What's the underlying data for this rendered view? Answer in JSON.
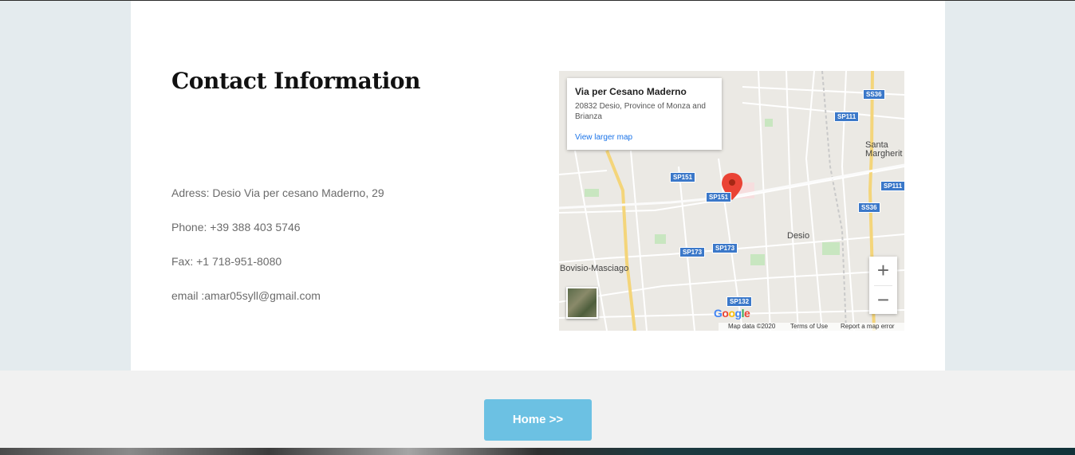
{
  "contact": {
    "title": "Contact Information",
    "address": "Adress: Desio Via per cesano Maderno, 29",
    "phone": "Phone: +39 388 403 5746",
    "fax": "Fax: +1 718-951-8080",
    "email": "email :amar05syll@gmail.com"
  },
  "map": {
    "popup_title": "Via per Cesano Maderno",
    "popup_address": "20832 Desio, Province of Monza and Brianza",
    "popup_link": "View larger map",
    "places": {
      "desio": "Desio",
      "bovisio": "Bovisio-Masciago",
      "santa_line1": "Santa",
      "santa_line2": "Margherit"
    },
    "road_badges": {
      "ss36_top": "SS36",
      "sp111_top": "SP111",
      "sp151_a": "SP151",
      "sp151_b": "SP151",
      "sp111_right": "SP111",
      "ss36_mid": "SS36",
      "sp173_a": "SP173",
      "sp173_b": "SP173",
      "sp132": "SP132"
    },
    "google_logo": "Google",
    "map_data": "Map data ©2020",
    "terms": "Terms of Use",
    "report": "Report a map error",
    "zoom_in": "+",
    "zoom_out": "−"
  },
  "nav": {
    "home_label": "Home >>"
  },
  "colors": {
    "button": "#6cc1e3",
    "pin": "#ea4335",
    "road_badge": "#3b78c9",
    "link": "#1a73e8"
  }
}
